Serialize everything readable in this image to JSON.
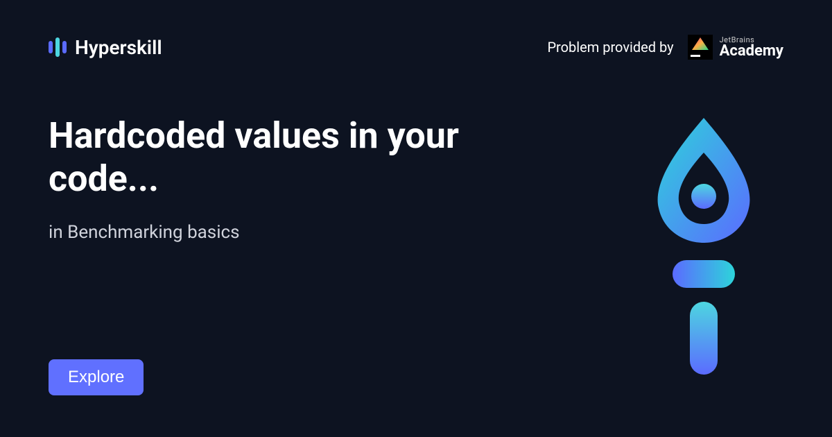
{
  "header": {
    "logo_text": "Hyperskill",
    "provider_label": "Problem provided by",
    "jb_small": "JetBrains",
    "jb_big": "Academy"
  },
  "content": {
    "title": "Hardcoded values in your code...",
    "subtitle": "in Benchmarking basics"
  },
  "actions": {
    "explore_label": "Explore"
  }
}
